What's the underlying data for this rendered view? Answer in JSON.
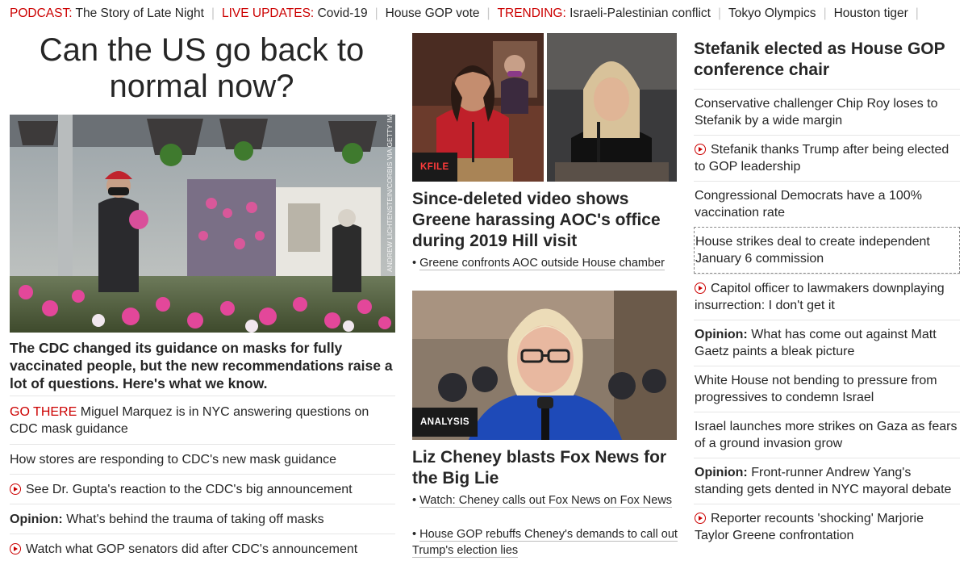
{
  "nav": [
    {
      "kicker": "PODCAST:",
      "text": "The Story of Late Night"
    },
    {
      "kicker": "LIVE UPDATES:",
      "text": "Covid-19"
    },
    {
      "kicker": "",
      "text": "House GOP vote"
    },
    {
      "kicker": "TRENDING:",
      "text": "Israeli-Palestinian conflict"
    },
    {
      "kicker": "",
      "text": "Tokyo Olympics"
    },
    {
      "kicker": "",
      "text": "Houston tiger"
    }
  ],
  "left": {
    "title": "Can the US go back to normal now?",
    "photo_credit": "ANDREW LICHTENSTEIN/CORBIS VIA GETTY IMAGES",
    "description": "The CDC changed its guidance on masks for fully vaccinated people, but the new recommendations raise a lot of questions. Here's what we know.",
    "links": [
      {
        "kicker": "GO THERE",
        "text": "Miguel Marquez is in NYC answering questions on CDC mask guidance",
        "video": false,
        "opinion": false
      },
      {
        "kicker": "",
        "text": "How stores are responding to CDC's new mask guidance",
        "video": false,
        "opinion": false
      },
      {
        "kicker": "",
        "text": "See Dr. Gupta's reaction to the CDC's big announcement",
        "video": true,
        "opinion": false
      },
      {
        "kicker": "Opinion:",
        "text": "What's behind the trauma of taking off masks",
        "video": false,
        "opinion": true
      },
      {
        "kicker": "",
        "text": "Watch what GOP senators did after CDC's announcement",
        "video": true,
        "opinion": false
      }
    ]
  },
  "middle": {
    "story1": {
      "badge": "KFILE",
      "headline": "Since-deleted video shows Greene harassing AOC's office during 2019 Hill visit",
      "bullets": [
        "Greene confronts AOC outside House chamber"
      ]
    },
    "story2": {
      "badge": "ANALYSIS",
      "headline": "Liz Cheney blasts Fox News for the Big Lie",
      "bullets": [
        "Watch: Cheney calls out Fox News on Fox News",
        "House GOP rebuffs Cheney's demands to call out Trump's election lies"
      ]
    }
  },
  "right": {
    "headline": "Stefanik elected as House GOP conference chair",
    "links": [
      {
        "kicker": "",
        "text": "Conservative challenger Chip Roy loses to Stefanik by a wide margin",
        "video": false
      },
      {
        "kicker": "",
        "text": "Stefanik thanks Trump after being elected to GOP leadership",
        "video": true
      },
      {
        "kicker": "",
        "text": "Congressional Democrats have a 100% vaccination rate",
        "video": false
      },
      {
        "kicker": "",
        "text": "House strikes deal to create independent January 6 commission",
        "video": false
      },
      {
        "kicker": "",
        "text": "Capitol officer to lawmakers downplaying insurrection: I don't get it",
        "video": true
      },
      {
        "kicker": "Opinion:",
        "text": "What has come out against Matt Gaetz paints a bleak picture",
        "video": false
      },
      {
        "kicker": "",
        "text": "White House not bending to pressure from progressives to condemn Israel",
        "video": false
      },
      {
        "kicker": "",
        "text": "Israel launches more strikes on Gaza as fears of a ground invasion grow",
        "video": false
      },
      {
        "kicker": "Opinion:",
        "text": "Front-runner Andrew Yang's standing gets dented in NYC mayoral debate",
        "video": false
      },
      {
        "kicker": "",
        "text": "Reporter recounts 'shocking' Marjorie Taylor Greene confrontation",
        "video": true
      }
    ]
  },
  "colors": {
    "accent": "#cc0000",
    "text": "#262626",
    "divider": "#e6e6e6"
  }
}
